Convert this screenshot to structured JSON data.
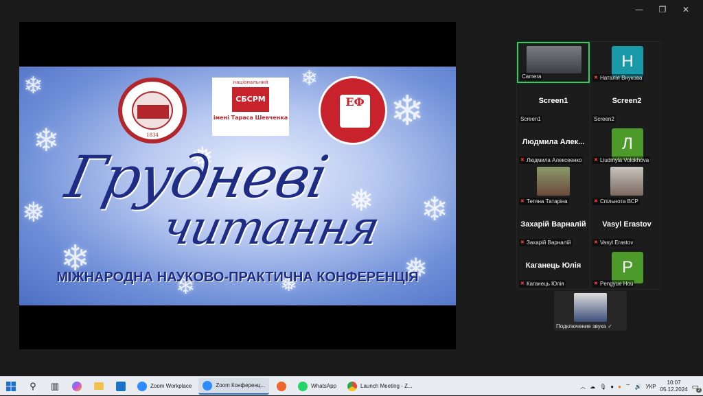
{
  "window_controls": {
    "minimize": "—",
    "restore": "❐",
    "close": "✕"
  },
  "slide": {
    "logo_left_year": "1834",
    "logo_mid_top": "національний",
    "logo_mid_center": "СБСРМ",
    "logo_mid_bottom": "імені Тараса Шевченка",
    "logo_right_text": "ЕФ",
    "title_line1": "Грудневі",
    "title_line2": "читання",
    "subtitle": "МІЖНАРОДНА НАУКОВО-ПРАКТИЧНА КОНФЕРЕНЦІЯ"
  },
  "participants": [
    {
      "label": "Camera",
      "kind": "camera",
      "muted": false
    },
    {
      "label": "Наталія Внукова",
      "kind": "avatar",
      "initial": "Н",
      "color": "#1a9aa8",
      "muted": true
    },
    {
      "label": "Screen1",
      "kind": "name",
      "big": "Screen1",
      "muted": false
    },
    {
      "label": "Screen2",
      "kind": "name",
      "big": "Screen2",
      "muted": false
    },
    {
      "label": "Людмила Алексеенко",
      "kind": "name",
      "big": "Людмила Алек...",
      "muted": true
    },
    {
      "label": "Liudmyla Volokhova",
      "kind": "avatar",
      "initial": "Л",
      "color": "#4c9a2a",
      "muted": true
    },
    {
      "label": "Тетяна Татаріна",
      "kind": "photo",
      "muted": true
    },
    {
      "label": "Спільнота ВСР",
      "kind": "photo",
      "muted": true
    },
    {
      "label": "Захарій Варналій",
      "kind": "name",
      "big": "Захарій Варналій",
      "muted": true
    },
    {
      "label": "Vasyl Erastov",
      "kind": "name",
      "big": "Vasyl Erastov",
      "muted": true
    },
    {
      "label": "Каганець Юлія",
      "kind": "name",
      "big": "Каганець Юлія",
      "muted": true
    },
    {
      "label": "Pengyue Hou",
      "kind": "avatar",
      "initial": "P",
      "color": "#4c9a2a",
      "muted": true
    }
  ],
  "self_view": {
    "label": "Подключение звука",
    "check": "✓"
  },
  "taskbar": {
    "apps": [
      {
        "label": "Zoom Workplace",
        "active": false,
        "color": "#2d8cff"
      },
      {
        "label": "Zoom Конференц...",
        "active": true,
        "color": "#2d8cff"
      },
      {
        "label": "WhatsApp",
        "active": false,
        "color": "#25d366"
      },
      {
        "label": "Launch Meeting - Z...",
        "active": false,
        "color": "#e04a3a"
      }
    ],
    "language": "УКР",
    "time": "10:07",
    "date": "05.12.2024",
    "notifications": "2"
  }
}
